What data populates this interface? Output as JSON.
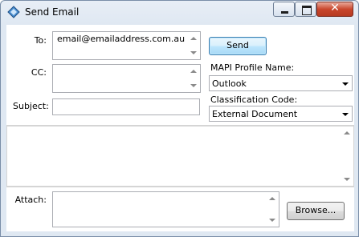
{
  "window": {
    "title": "Send Email",
    "close_glyph": "✕"
  },
  "form": {
    "to_label": "To:",
    "to_value": "email@emailaddress.com.au",
    "cc_label": "CC:",
    "cc_value": "",
    "subject_label": "Subject:",
    "subject_value": "",
    "send_label": "Send",
    "mapi_label": "MAPI Profile Name:",
    "mapi_value": "Outlook",
    "classification_label": "Classification Code:",
    "classification_value": "External Document",
    "body_value": "",
    "attach_label": "Attach:",
    "attach_value": "",
    "browse_label": "Browse..."
  },
  "icons": [
    "app-icon",
    "minimize-icon",
    "maximize-icon",
    "close-icon",
    "scroll-up-arrow-icon",
    "scroll-down-arrow-icon",
    "dropdown-arrow-icon"
  ]
}
